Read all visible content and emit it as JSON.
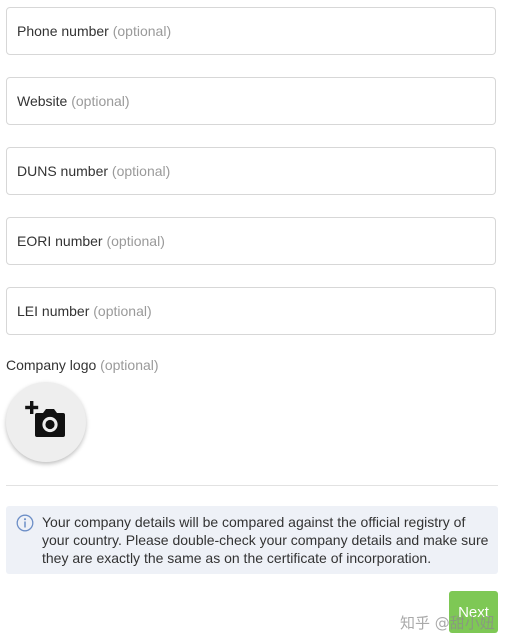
{
  "fields": [
    {
      "label": "Phone number",
      "optional": "(optional)"
    },
    {
      "label": "Website",
      "optional": "(optional)"
    },
    {
      "label": "DUNS number",
      "optional": "(optional)"
    },
    {
      "label": "EORI number",
      "optional": "(optional)"
    },
    {
      "label": "LEI number",
      "optional": "(optional)"
    }
  ],
  "logo": {
    "label": "Company logo",
    "optional": "(optional)",
    "icon": "add-photo-camera-icon"
  },
  "notice": {
    "icon": "info-icon",
    "text": "Your company details will be compared against the official registry of your country. Please double-check your company details and make sure they are exactly the same as on the certificate of incorporation."
  },
  "actions": {
    "next_label": "Next"
  },
  "watermark": {
    "text": "知乎 @甜小妞"
  },
  "colors": {
    "next_button": "#7ec855",
    "notice_background": "#eef1f7",
    "optional_text": "#9a9a9a",
    "field_border": "#d7d7d7"
  }
}
